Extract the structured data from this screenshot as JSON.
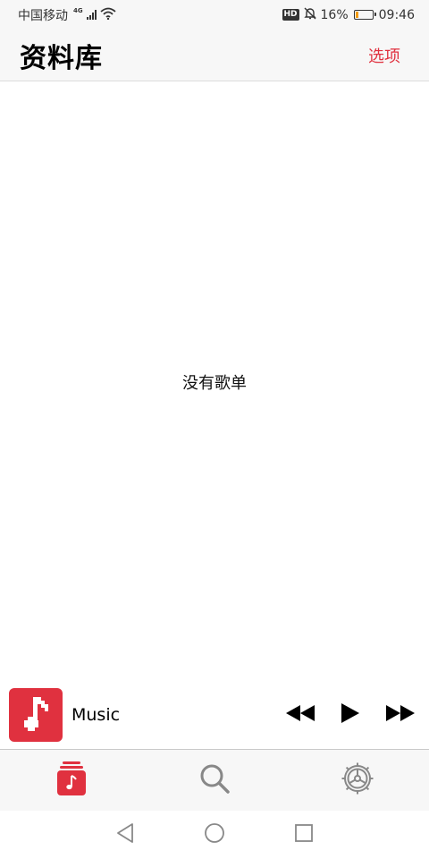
{
  "status_bar": {
    "carrier": "中国移动",
    "network": "4G",
    "hd_badge": "HD",
    "battery_percent": "16%",
    "battery_level": 0.16,
    "time": "09:46"
  },
  "header": {
    "title": "资料库",
    "options_label": "选项"
  },
  "main": {
    "empty_message": "没有歌单"
  },
  "mini_player": {
    "track_title": "Music",
    "artwork_icon": "music-note-icon",
    "controls": [
      "rewind-icon",
      "play-icon",
      "fast-forward-icon"
    ]
  },
  "tab_bar": {
    "tabs": [
      {
        "name": "library",
        "icon": "library-icon",
        "active": true
      },
      {
        "name": "search",
        "icon": "search-icon",
        "active": false
      },
      {
        "name": "settings",
        "icon": "settings-icon",
        "active": false
      }
    ]
  },
  "nav_bar": {
    "buttons": [
      "back-icon",
      "home-icon",
      "recents-icon"
    ]
  },
  "colors": {
    "accent": "#e0313f",
    "bar_background": "#f7f7f7",
    "inactive_icon": "#888888"
  }
}
